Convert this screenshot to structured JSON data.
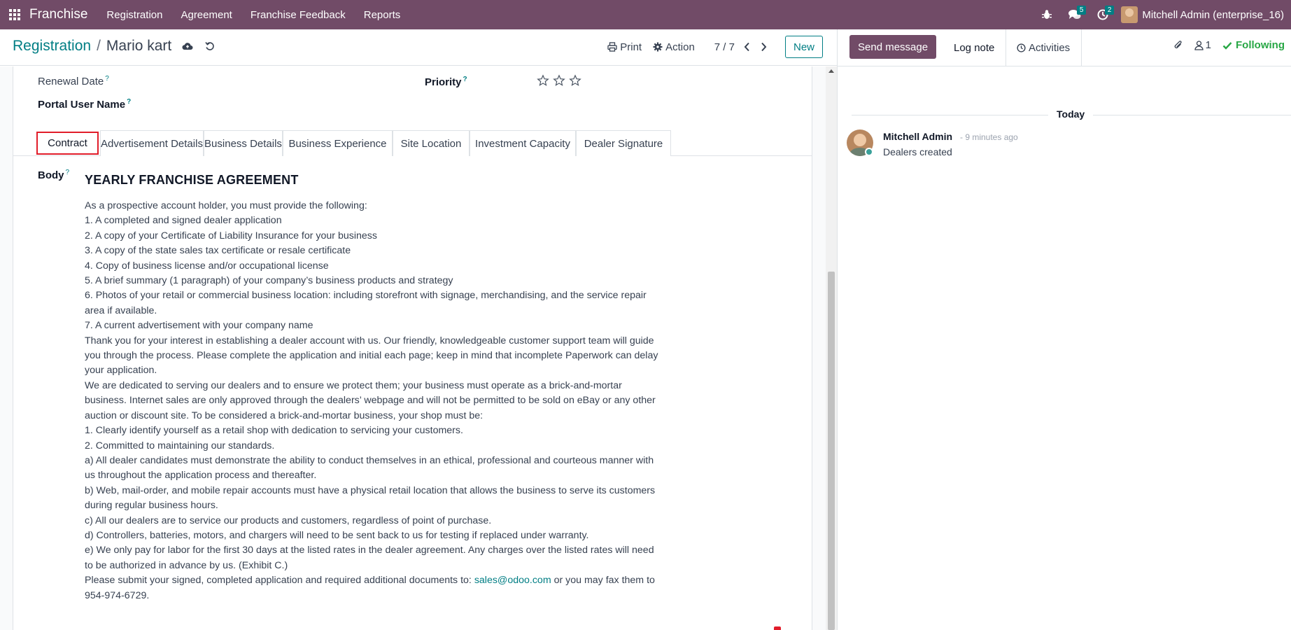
{
  "navbar": {
    "brand": "Franchise",
    "menu": [
      "Registration",
      "Agreement",
      "Franchise Feedback",
      "Reports"
    ],
    "messages_badge": "5",
    "activities_badge": "2",
    "user_name": "Mitchell Admin (enterprise_16)"
  },
  "control": {
    "breadcrumb_parent": "Registration",
    "breadcrumb_separator": "/",
    "breadcrumb_current": "Mario kart",
    "print_label": "Print",
    "action_label": "Action",
    "pager": "7 / 7",
    "new_label": "New"
  },
  "form": {
    "renewal_date_label": "Renewal Date",
    "priority_label": "Priority",
    "portal_user_label": "Portal User Name",
    "help_mark": "?",
    "tabs": [
      "Contract",
      "Advertisement Details",
      "Business Details",
      "Business Experience",
      "Site Location",
      "Investment Capacity",
      "Dealer Signature"
    ],
    "active_tab": "Contract",
    "body_label": "Body",
    "agreement_title": "YEARLY FRANCHISE AGREEMENT",
    "lines": [
      "As a prospective account holder, you must provide the following:",
      "1. A completed and signed dealer application",
      "2. A copy of your Certificate of Liability Insurance for your business",
      "3. A copy of the state sales tax certificate or resale certificate",
      "4. Copy of business license and/or occupational license",
      "5. A brief summary (1 paragraph) of your company’s business products and strategy",
      "6. Photos of your retail or commercial business location: including storefront with signage, merchandising, and the service repair area if available.",
      "7. A current advertisement with your company name",
      "Thank you for your interest in establishing a dealer account with us. Our friendly, knowledgeable customer support team will guide you through the process. Please complete the application and initial each page; keep in mind that incomplete Paperwork can delay your application.",
      "We are dedicated to serving our dealers and to ensure we protect them; your business must operate as a brick-and-mortar business. Internet sales are only approved through the dealers’ webpage and will not be permitted to be sold on eBay or any other auction or discount site. To be considered a brick-and-mortar business, your shop must be:",
      "1. Clearly identify yourself as a retail shop with dedication to servicing your customers.",
      "2. Committed to maintaining our standards.",
      "a) All dealer candidates must demonstrate the ability to conduct themselves in an ethical, professional and courteous manner with us throughout the application process and thereafter.",
      "b) Web, mail-order, and mobile repair accounts must have a physical retail location that allows the business to serve its customers during regular business hours.",
      "c) All our dealers are to service our products and customers, regardless of point of purchase.",
      "d) Controllers, batteries, motors, and chargers will need to be sent back to us for testing if replaced under warranty.",
      "e) We only pay for labor for the first 30 days at the listed rates in the dealer agreement. Any charges over the listed rates will need to be authorized in advance by us. (Exhibit C.)"
    ],
    "final_before": "Please submit your signed, completed application and required additional documents to: ",
    "final_email": "sales@odoo.com",
    "final_after": " or you may fax them to 954-974-6729."
  },
  "chatter": {
    "send_message": "Send message",
    "log_note": "Log note",
    "activities": "Activities",
    "followers_count": "1",
    "following": "Following",
    "today": "Today",
    "message": {
      "author": "Mitchell Admin",
      "time": "- 9 minutes ago",
      "body": "Dealers created"
    }
  },
  "colors": {
    "brand": "#714B67",
    "accent": "#017e84",
    "following": "#28a745",
    "active_tab_outline": "#e11d2a"
  }
}
